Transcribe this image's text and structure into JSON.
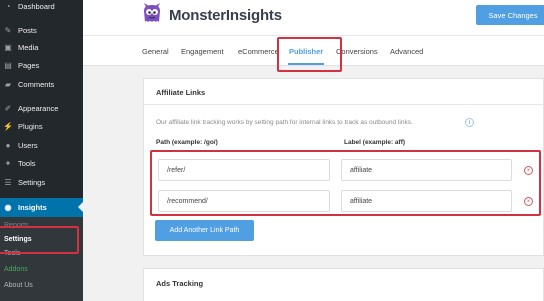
{
  "sidebar": {
    "items": [
      {
        "label": "Dashboard",
        "icon": "dashboard-icon",
        "glyph": "◔"
      },
      {
        "label": "Posts",
        "icon": "pin-icon",
        "glyph": "✎"
      },
      {
        "label": "Media",
        "icon": "media-icon",
        "glyph": "▣"
      },
      {
        "label": "Pages",
        "icon": "pages-icon",
        "glyph": "▤"
      },
      {
        "label": "Comments",
        "icon": "comments-icon",
        "glyph": "▰"
      },
      {
        "label": "Appearance",
        "icon": "brush-icon",
        "glyph": "✐"
      },
      {
        "label": "Plugins",
        "icon": "plugin-icon",
        "glyph": "⚡"
      },
      {
        "label": "Users",
        "icon": "user-icon",
        "glyph": "●"
      },
      {
        "label": "Tools",
        "icon": "wrench-icon",
        "glyph": "✦"
      },
      {
        "label": "Settings",
        "icon": "settings-icon",
        "glyph": "☰"
      },
      {
        "label": "Insights",
        "icon": "insights-icon",
        "glyph": "◉"
      }
    ],
    "submenu": {
      "reports": "Reports",
      "settings": "Settings",
      "tools": "Tools",
      "addons": "Addons",
      "about": "About Us"
    }
  },
  "header": {
    "brand": "MonsterInsights",
    "save_label": "Save Changes"
  },
  "tabs": [
    "General",
    "Engagement",
    "eCommerce",
    "Publisher",
    "Conversions",
    "Advanced"
  ],
  "active_tab": "Publisher",
  "affiliate": {
    "title": "Affiliate Links",
    "description": "Our affiliate link tracking works by setting path for internal links to track as outbound links.",
    "path_label": "Path (example: /go/)",
    "label_label": "Label (example: aff)",
    "rows": [
      {
        "path": "/refer/",
        "label": "affiliate"
      },
      {
        "path": "/recommend/",
        "label": "affiliate"
      }
    ],
    "add_label": "Add Another Link Path",
    "info_glyph": "i",
    "remove_glyph": "×"
  },
  "ads": {
    "title": "Ads Tracking"
  },
  "colors": {
    "accent": "#509fe2",
    "wp_blue": "#0073aa",
    "sidebar_bg": "#23282d",
    "highlight": "#d23142",
    "addons_green": "#49a95f"
  }
}
